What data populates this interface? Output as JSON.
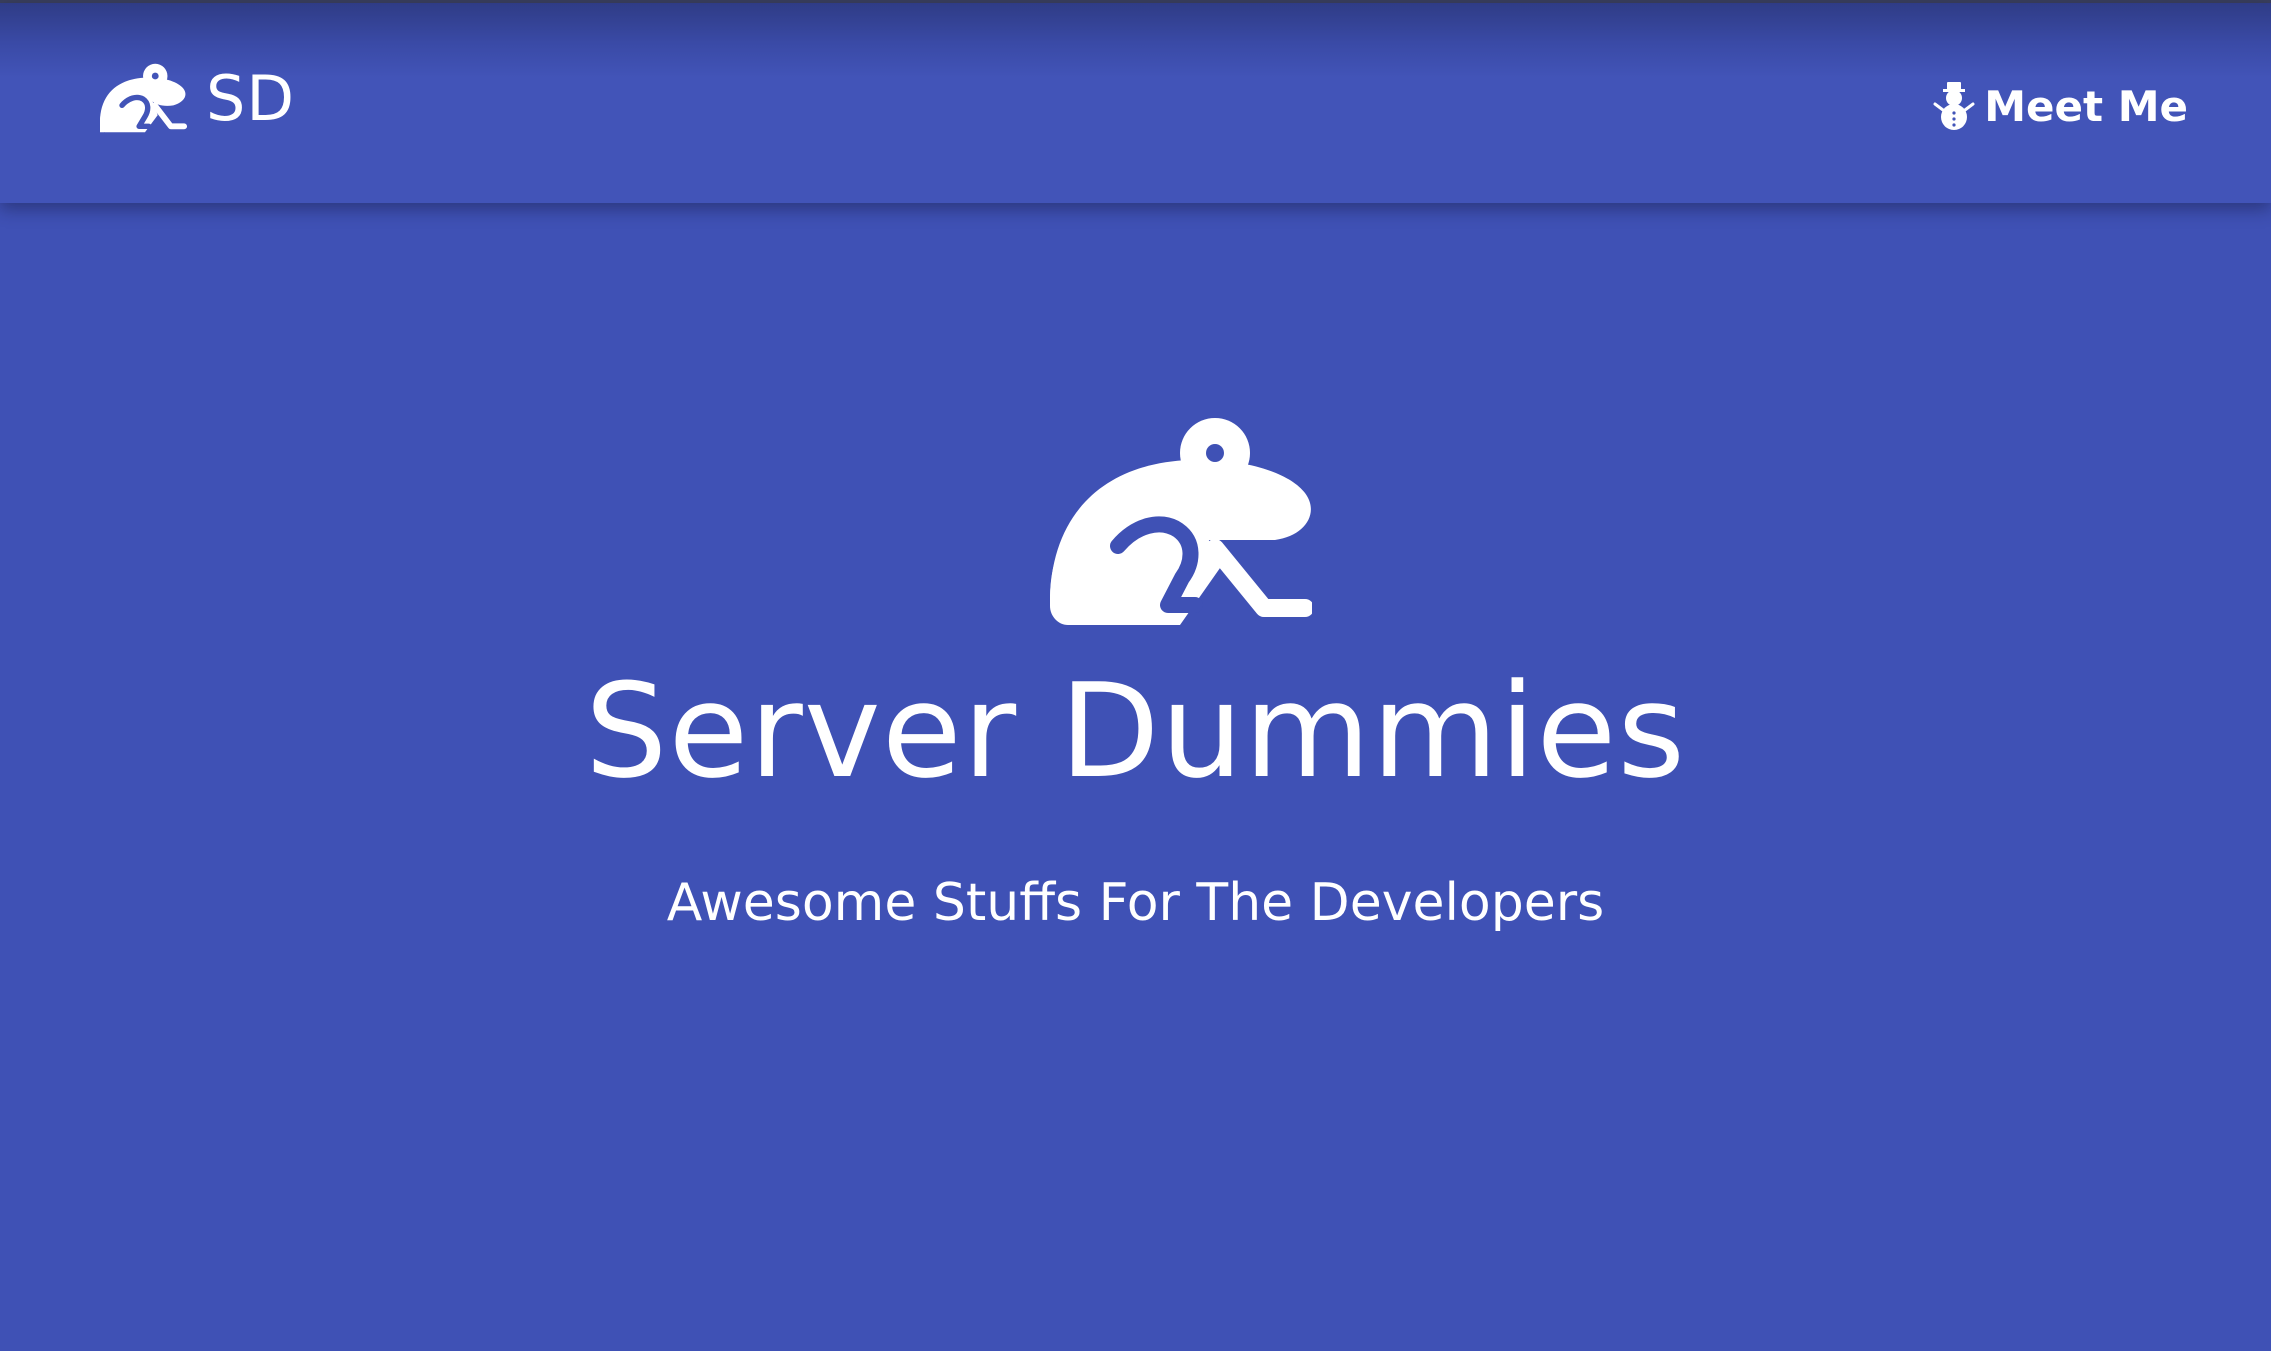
{
  "navbar": {
    "brand": {
      "logo_icon": "frog-icon",
      "text": "SD"
    },
    "link": {
      "icon": "snowman-icon",
      "label": "Meet Me"
    }
  },
  "hero": {
    "logo_icon": "frog-icon",
    "title": "Server Dummies",
    "subtitle": "Awesome Stuffs For The Developers"
  },
  "colors": {
    "background": "#3f51b5",
    "navbar": "#4254b8",
    "text": "#ffffff"
  }
}
